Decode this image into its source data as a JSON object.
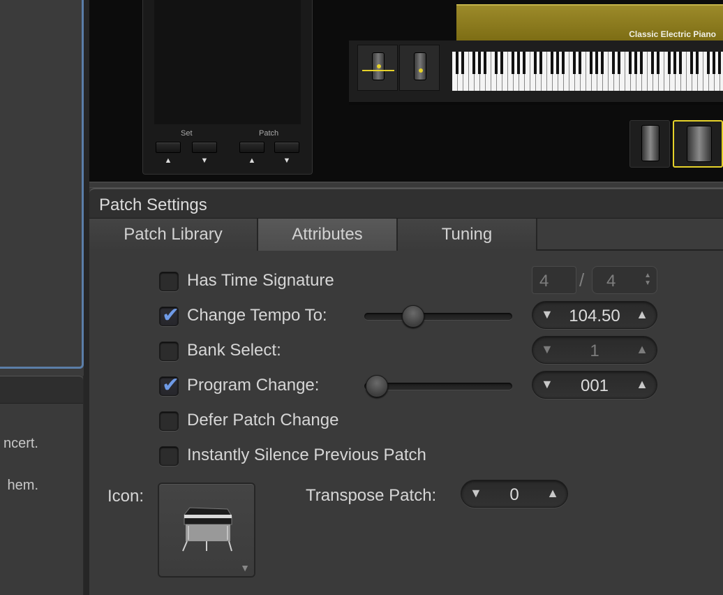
{
  "left_panel": {
    "line1": "ncert.",
    "line2": "hem."
  },
  "instrument": {
    "piano_name": "Classic Electric Piano",
    "set_label": "Set",
    "patch_label": "Patch",
    "arrow_up": "▲",
    "arrow_down": "▼"
  },
  "patch_settings": {
    "title": "Patch Settings",
    "tabs": [
      {
        "label": "Patch Library"
      },
      {
        "label": "Attributes",
        "active": true
      },
      {
        "label": "Tuning"
      }
    ],
    "has_time_signature": {
      "label": "Has Time Signature",
      "checked": false,
      "numerator": "4",
      "slash": "/",
      "denominator": "4"
    },
    "change_tempo": {
      "label": "Change Tempo To:",
      "checked": true,
      "value": "104.50"
    },
    "bank_select": {
      "label": "Bank Select:",
      "checked": false,
      "value": "1"
    },
    "program_change": {
      "label": "Program Change:",
      "checked": true,
      "value": "001"
    },
    "defer_patch_change": {
      "label": "Defer Patch Change",
      "checked": false
    },
    "instantly_silence": {
      "label": "Instantly Silence Previous Patch",
      "checked": false
    },
    "icon_label": "Icon:",
    "transpose": {
      "label": "Transpose Patch:",
      "value": "0"
    },
    "checkmark": "✔",
    "stepper_down": "▼",
    "stepper_up": "▲",
    "dropdown_glyph": "▼"
  },
  "colors": {
    "accent_check": "#6f9be8",
    "piano_gold": "#9c8a2a",
    "selection_border": "#5b7ea8"
  }
}
